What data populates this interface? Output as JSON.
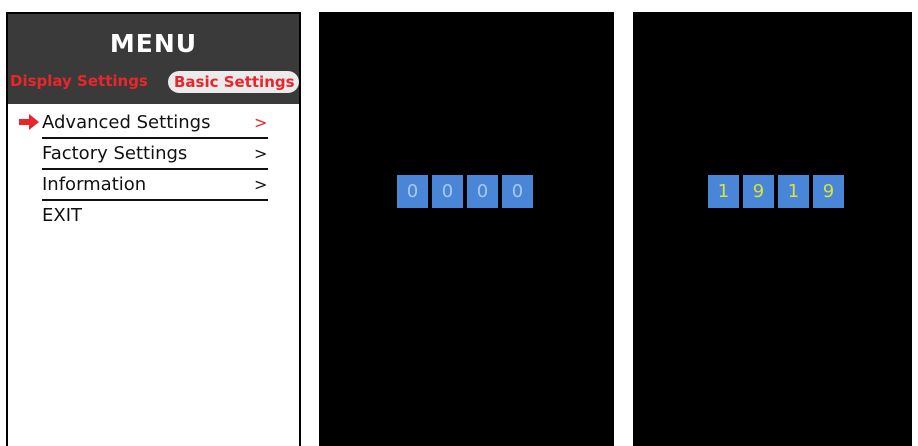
{
  "menu_screen": {
    "title": "MENU",
    "tabs": [
      {
        "label": "Display Settings"
      },
      {
        "label": "Basic Settings"
      }
    ],
    "items": [
      {
        "label": "Advanced Settings",
        "chevron": ">",
        "selected": true
      },
      {
        "label": "Factory Settings",
        "chevron": ">"
      },
      {
        "label": "Information",
        "chevron": ">"
      },
      {
        "label": "EXIT"
      }
    ],
    "colors": {
      "header_bg": "#3a3a3a",
      "accent": "#e8262b"
    },
    "selection_icon": "arrow-right-icon"
  },
  "pin_entry_empty": {
    "digits": [
      "0",
      "0",
      "0",
      "0"
    ]
  },
  "pin_entry_filled": {
    "digits": [
      "1",
      "9",
      "1",
      "9"
    ]
  },
  "colors": {
    "digit_box": "#4a86d8",
    "digit_empty_text": "#a9c7ef",
    "digit_filled_text": "#d7e23a",
    "screen_bg": "#000000"
  }
}
